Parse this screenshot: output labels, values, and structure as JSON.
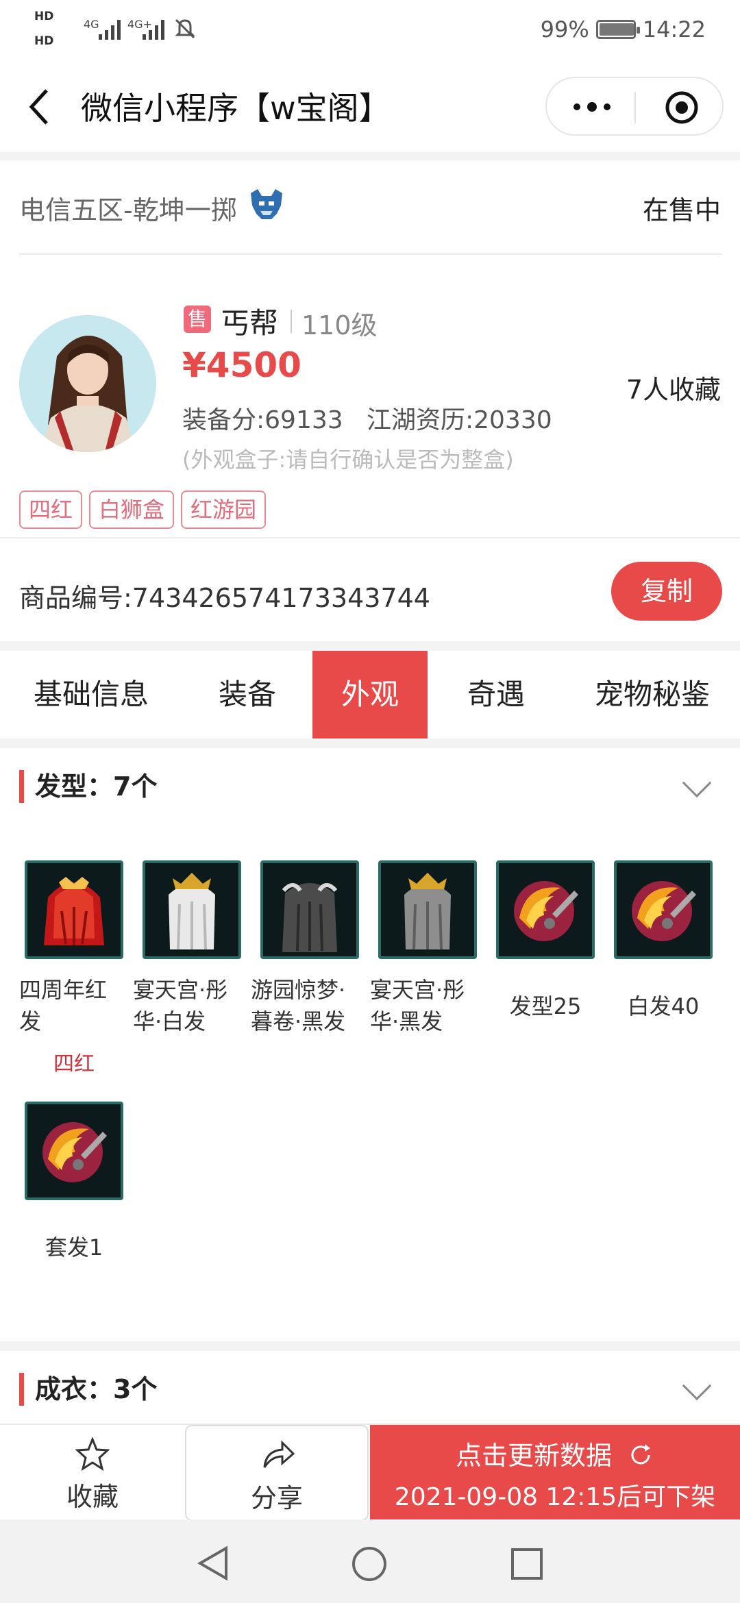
{
  "status_bar": {
    "hd1": "HD",
    "hd2": "HD",
    "signal1": "4G",
    "signal2": "4G+",
    "battery_percent": "99%",
    "battery_level": 0.99,
    "time": "14:22"
  },
  "title_bar": {
    "title": "微信小程序【w宝阁】",
    "icons": [
      "back-arrow-icon",
      "more-dots-icon",
      "target-circle-icon"
    ]
  },
  "listing": {
    "server": "电信五区-乾坤一掷",
    "status": "在售中",
    "sale_badge": "售",
    "sect": "丐帮",
    "level": "110级",
    "price": "¥4500",
    "stats": "装备分:69133   江湖资历:20330",
    "note": "(外观盒子:请自行确认是否为整盒)",
    "favorites": "7人收藏",
    "tags": [
      "四红",
      "白狮盒",
      "红游园"
    ],
    "item_no": "商品编号:743426574173343744",
    "copy_label": "复制"
  },
  "tabs": [
    {
      "label": "基础信息",
      "active": false
    },
    {
      "label": "装备",
      "active": false
    },
    {
      "label": "外观",
      "active": true
    },
    {
      "label": "奇遇",
      "active": false
    },
    {
      "label": "宠物秘鉴",
      "active": false
    }
  ],
  "hair_section": {
    "title": "发型：7个",
    "items": [
      {
        "name": "四周年红发",
        "tag": "四红",
        "icon": "red-hair-icon"
      },
      {
        "name": "宴天宫·彤华·白发",
        "tag": "",
        "icon": "white-hair-icon"
      },
      {
        "name": "游园惊梦·暮卷·黑发",
        "tag": "",
        "icon": "black-hair-icon"
      },
      {
        "name": "宴天宫·彤华·黑发",
        "tag": "",
        "icon": "dark-hair-icon"
      },
      {
        "name": "发型25",
        "tag": "",
        "icon": "scissors-flame-icon"
      },
      {
        "name": "白发40",
        "tag": "",
        "icon": "scissors-flame-icon"
      },
      {
        "name": "套发1",
        "tag": "",
        "icon": "scissors-flame-icon"
      }
    ]
  },
  "clothes_section": {
    "title": "成衣：3个"
  },
  "bottom_bar": {
    "favorite_label": "收藏",
    "share_label": "分享",
    "update_title": "点击更新数据",
    "update_sub": "2021-09-08 12:15后可下架"
  },
  "colors": {
    "accent": "#e84a4a",
    "tag_border": "#e98a95",
    "teal_frame": "#2c6b63"
  }
}
